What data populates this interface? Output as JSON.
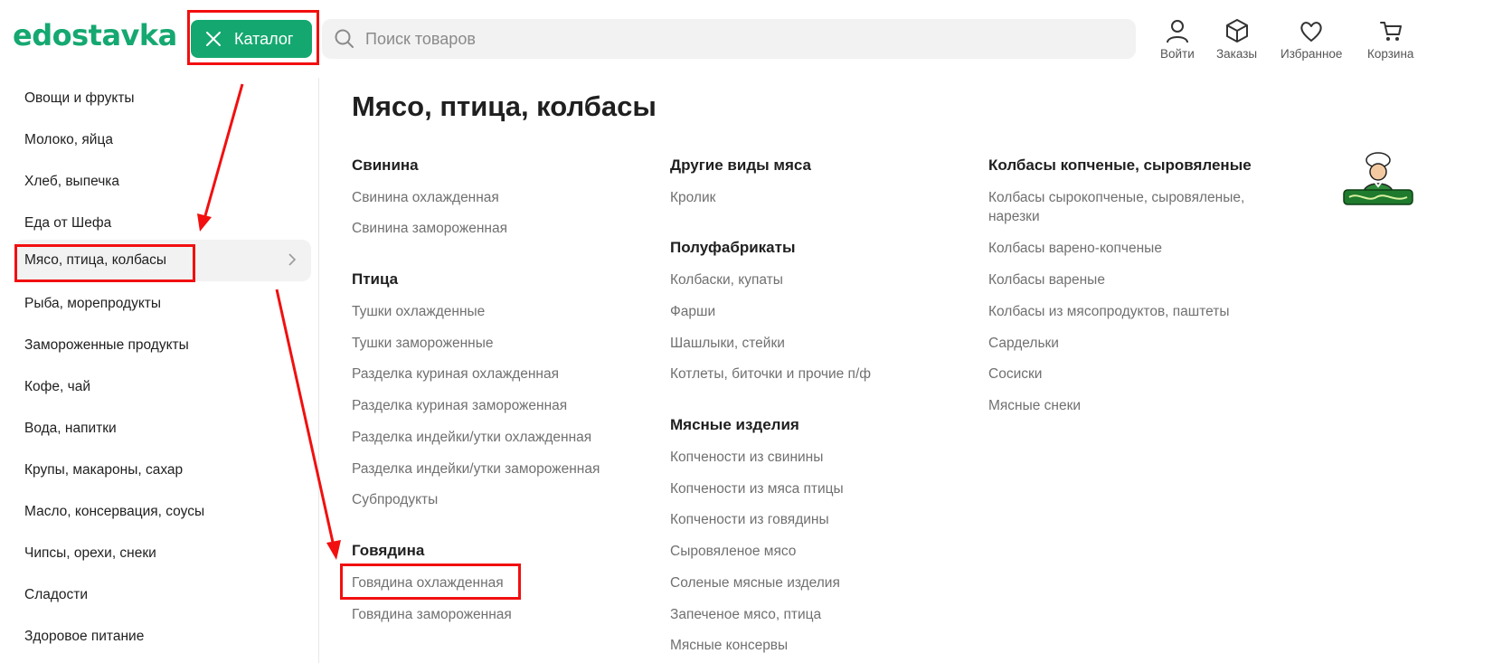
{
  "header": {
    "logo": "edostavka",
    "catalog_label": "Каталог",
    "search_placeholder": "Поиск товаров",
    "actions": [
      {
        "label": "Войти",
        "icon": "user-icon"
      },
      {
        "label": "Заказы",
        "icon": "box-icon"
      },
      {
        "label": "Избранное",
        "icon": "heart-icon"
      },
      {
        "label": "Корзина",
        "icon": "cart-icon"
      }
    ]
  },
  "sidebar": {
    "items": [
      {
        "label": "Овощи и фрукты"
      },
      {
        "label": "Молоко, яйца"
      },
      {
        "label": "Хлеб, выпечка"
      },
      {
        "label": "Еда от Шефа"
      },
      {
        "label": "Мясо, птица, колбасы",
        "active": true
      },
      {
        "label": "Рыба, морепродукты"
      },
      {
        "label": "Замороженные продукты"
      },
      {
        "label": "Кофе, чай"
      },
      {
        "label": "Вода, напитки"
      },
      {
        "label": "Крупы, макароны, сахар"
      },
      {
        "label": "Масло, консервация, соусы"
      },
      {
        "label": "Чипсы, орехи, снеки"
      },
      {
        "label": "Сладости"
      },
      {
        "label": "Здоровое питание"
      }
    ]
  },
  "main": {
    "title": "Мясо, птица, колбасы",
    "columns": [
      {
        "groups": [
          {
            "title": "Свинина",
            "links": [
              "Свинина охлажденная",
              "Свинина замороженная"
            ]
          },
          {
            "title": "Птица",
            "links": [
              "Тушки охлажденные",
              "Тушки замороженные",
              "Разделка куриная охлажденная",
              "Разделка куриная замороженная",
              "Разделка индейки/утки охлажденная",
              "Разделка индейки/утки замороженная",
              "Субпродукты"
            ]
          },
          {
            "title": "Говядина",
            "links": [
              "Говядина охлажденная",
              "Говядина замороженная"
            ]
          }
        ]
      },
      {
        "groups": [
          {
            "title": "Другие виды мяса",
            "links": [
              "Кролик"
            ]
          },
          {
            "title": "Полуфабрикаты",
            "links": [
              "Колбаски, купаты",
              "Фарши",
              "Шашлыки, стейки",
              "Котлеты, биточки и прочие п/ф"
            ]
          },
          {
            "title": "Мясные изделия",
            "links": [
              "Копчености из свинины",
              "Копчености из мяса птицы",
              "Копчености из говядины",
              "Сыровяленое мясо",
              "Соленые мясные изделия",
              "Запеченое мясо, птица",
              "Мясные консервы"
            ]
          }
        ]
      },
      {
        "groups": [
          {
            "title": "Колбасы копченые, сыровяленые",
            "links": [
              "Колбасы сырокопченые, сыровяленые, нарезки",
              "Колбасы варено-копченые",
              "Колбасы вареные",
              "Колбасы из мясопродуктов, паштеты",
              "Сардельки",
              "Сосиски",
              "Мясные снеки"
            ]
          }
        ]
      }
    ],
    "promo_logo": "Шеф-онлайн"
  },
  "colors": {
    "brand_green": "#14a870",
    "annotation_red": "#f20f0f"
  }
}
